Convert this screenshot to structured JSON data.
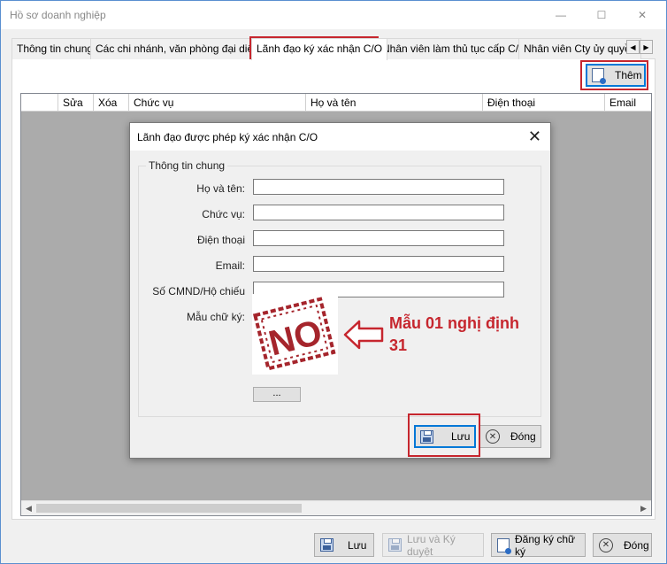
{
  "window": {
    "title": "Hồ sơ doanh nghiệp",
    "controls": {
      "minimize": "—",
      "maximize": "☐",
      "close": "✕"
    }
  },
  "tabs": [
    {
      "label": "Thông tin chung"
    },
    {
      "label": "Các chi nhánh, văn phòng đại diện"
    },
    {
      "label": "Lãnh đạo ký xác nhận C/O"
    },
    {
      "label": "Nhân viên làm thủ tục cấp C/O"
    },
    {
      "label": "Nhân viên Cty ủy quyền"
    }
  ],
  "tab_scroll": {
    "left": "◀",
    "right": "▶"
  },
  "toolbar": {
    "add_label": "Thêm"
  },
  "grid": {
    "columns": [
      "",
      "Sửa",
      "Xóa",
      "Chức vụ",
      "Họ và tên",
      "Điện thoại",
      "Email"
    ],
    "scroll_left": "◀",
    "scroll_right": "▶"
  },
  "dialog": {
    "title": "Lãnh đạo được phép ký xác nhận C/O",
    "close": "✕",
    "group_title": "Thông tin chung",
    "fields": [
      {
        "label": "Họ và tên:",
        "value": ""
      },
      {
        "label": "Chức vụ:",
        "value": ""
      },
      {
        "label": "Điện thoại",
        "value": ""
      },
      {
        "label": "Email:",
        "value": ""
      },
      {
        "label": "Số CMND/Hộ chiếu",
        "value": ""
      }
    ],
    "signature_label": "Mẫu chữ ký:",
    "signature_text": "NO",
    "browse_label": "...",
    "save_label": "Lưu",
    "close_label": "Đóng"
  },
  "annotation": {
    "text": "Mẫu 01 nghị định 31",
    "color": "#c6262e"
  },
  "footer": {
    "save_label": "Lưu",
    "save_approve_label": "Lưu và Ký duyệt",
    "register_signature_label": "Đăng ký chữ ký",
    "close_label": "Đóng"
  }
}
